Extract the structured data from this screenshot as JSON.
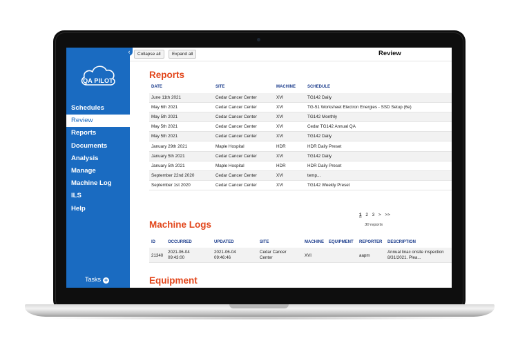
{
  "app": {
    "logo_text": "QA PILOT",
    "collapse_icon": "chevron-left-icon"
  },
  "sidebar": {
    "items": [
      {
        "label": "Schedules",
        "active": false
      },
      {
        "label": "Review",
        "active": true
      },
      {
        "label": "Reports",
        "active": false
      },
      {
        "label": "Documents",
        "active": false
      },
      {
        "label": "Analysis",
        "active": false
      },
      {
        "label": "Manage",
        "active": false
      },
      {
        "label": "Machine Log",
        "active": false
      },
      {
        "label": "ILS",
        "active": false
      },
      {
        "label": "Help",
        "active": false
      }
    ],
    "tasks_label": "Tasks",
    "tasks_icon": "plus-circle-icon"
  },
  "toolbar": {
    "collapse_all": "Collapse all",
    "expand_all": "Expand all",
    "title": "Review"
  },
  "reports": {
    "title": "Reports",
    "columns": [
      "DATE",
      "SITE",
      "MACHINE",
      "SCHEDULE"
    ],
    "rows": [
      [
        "June 11th 2021",
        "Cedar Cancer Center",
        "XVI",
        "TG142 Daily"
      ],
      [
        "May 6th 2021",
        "Cedar Cancer Center",
        "XVI",
        "TG-51 Worksheet Electron Energies - SSD Setup (6e)"
      ],
      [
        "May 5th 2021",
        "Cedar Cancer Center",
        "XVI",
        "TG142 Monthly"
      ],
      [
        "May 5th 2021",
        "Cedar Cancer Center",
        "XVI",
        "Cedar TG142 Annual QA"
      ],
      [
        "May 5th 2021",
        "Cedar Cancer Center",
        "XVI",
        "TG142 Daily"
      ],
      [
        "January 29th 2021",
        "Maple Hospital",
        "HDR",
        "HDR Daily Preset"
      ],
      [
        "January 5th 2021",
        "Cedar Cancer Center",
        "XVI",
        "TG142 Daily"
      ],
      [
        "January 5th 2021",
        "Maple Hospital",
        "HDR",
        "HDR Daily Preset"
      ],
      [
        "September 22nd 2020",
        "Cedar Cancer Center",
        "XVI",
        "temp..."
      ],
      [
        "September 1st 2020",
        "Cedar Cancer Center",
        "XVI",
        "TG142 Weekly Preset"
      ]
    ],
    "pager": {
      "pages": [
        "1",
        "2",
        "3",
        ">",
        ">>"
      ],
      "current": "1",
      "count": "30 reports"
    }
  },
  "machine_logs": {
    "title": "Machine Logs",
    "columns": [
      "ID",
      "OCCURRED",
      "UPDATED",
      "SITE",
      "MACHINE",
      "EQUIPMENT",
      "REPORTER",
      "DESCRIPTION"
    ],
    "rows": [
      {
        "id": "21340",
        "occurred_date": "2021-06-04",
        "occurred_time": "09:43:00",
        "updated_date": "2021-06-04",
        "updated_time": "09:46:46",
        "site_line1": "Cedar Cancer",
        "site_line2": "Center",
        "machine": "XVI",
        "equipment": "",
        "reporter": "aapm",
        "description_line1": "Annual linac onsite inspection",
        "description_line2": "8/31/2021. Plea..."
      }
    ]
  },
  "equipment": {
    "title": "Equipment"
  },
  "colors": {
    "sidebar_blue": "#1a6bc1",
    "section_orange": "#e2461b",
    "header_navy": "#1b3c8c"
  }
}
